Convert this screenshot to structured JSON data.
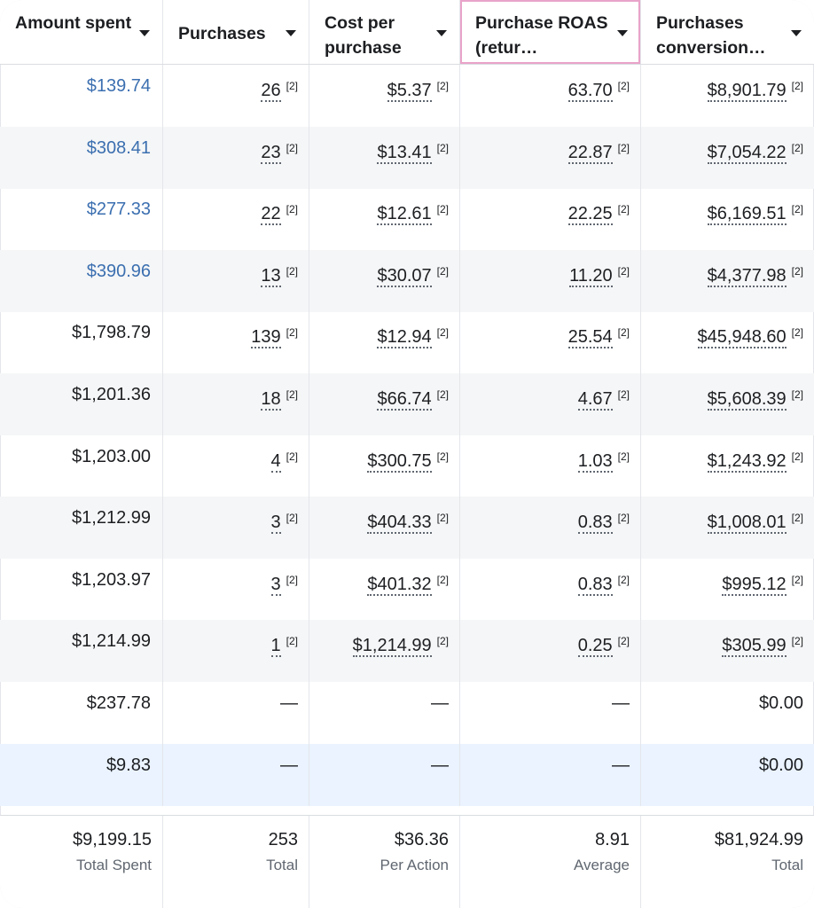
{
  "columns": [
    {
      "label": "Amount spent"
    },
    {
      "label": "Purchases"
    },
    {
      "label": "Cost per purchase"
    },
    {
      "label": "Purchase ROAS (retur…"
    },
    {
      "label": "Purchases conversion…"
    }
  ],
  "footnote": "[2]",
  "dash": "—",
  "rows": [
    {
      "amount": "$139.74",
      "purchases": "26",
      "cost": "$5.37",
      "roas": "63.70",
      "conv": "$8,901.79"
    },
    {
      "amount": "$308.41",
      "purchases": "23",
      "cost": "$13.41",
      "roas": "22.87",
      "conv": "$7,054.22"
    },
    {
      "amount": "$277.33",
      "purchases": "22",
      "cost": "$12.61",
      "roas": "22.25",
      "conv": "$6,169.51"
    },
    {
      "amount": "$390.96",
      "purchases": "13",
      "cost": "$30.07",
      "roas": "11.20",
      "conv": "$4,377.98"
    },
    {
      "amount": "$1,798.79",
      "purchases": "139",
      "cost": "$12.94",
      "roas": "25.54",
      "conv": "$45,948.60"
    },
    {
      "amount": "$1,201.36",
      "purchases": "18",
      "cost": "$66.74",
      "roas": "4.67",
      "conv": "$5,608.39"
    },
    {
      "amount": "$1,203.00",
      "purchases": "4",
      "cost": "$300.75",
      "roas": "1.03",
      "conv": "$1,243.92"
    },
    {
      "amount": "$1,212.99",
      "purchases": "3",
      "cost": "$404.33",
      "roas": "0.83",
      "conv": "$1,008.01"
    },
    {
      "amount": "$1,203.97",
      "purchases": "3",
      "cost": "$401.32",
      "roas": "0.83",
      "conv": "$995.12"
    },
    {
      "amount": "$1,214.99",
      "purchases": "1",
      "cost": "$1,214.99",
      "roas": "0.25",
      "conv": "$305.99"
    },
    {
      "amount": "$237.78",
      "purchases": "—",
      "cost": "—",
      "roas": "—",
      "conv": "$0.00"
    },
    {
      "amount": "$9.83",
      "purchases": "—",
      "cost": "—",
      "roas": "—",
      "conv": "$0.00"
    }
  ],
  "totals": [
    {
      "value": "$9,199.15",
      "label": "Total Spent"
    },
    {
      "value": "253",
      "label": "Total"
    },
    {
      "value": "$36.36",
      "label": "Per Action"
    },
    {
      "value": "8.91",
      "label": "Average"
    },
    {
      "value": "$81,924.99",
      "label": "Total"
    }
  ],
  "colors": {
    "link": "#3b6fb0",
    "row_alt": "#f5f6f7",
    "row_highlight": "#eaf3ff",
    "selected_header_border": "#e9a3c9",
    "border": "#e4e6eb",
    "muted_text": "#606770"
  }
}
